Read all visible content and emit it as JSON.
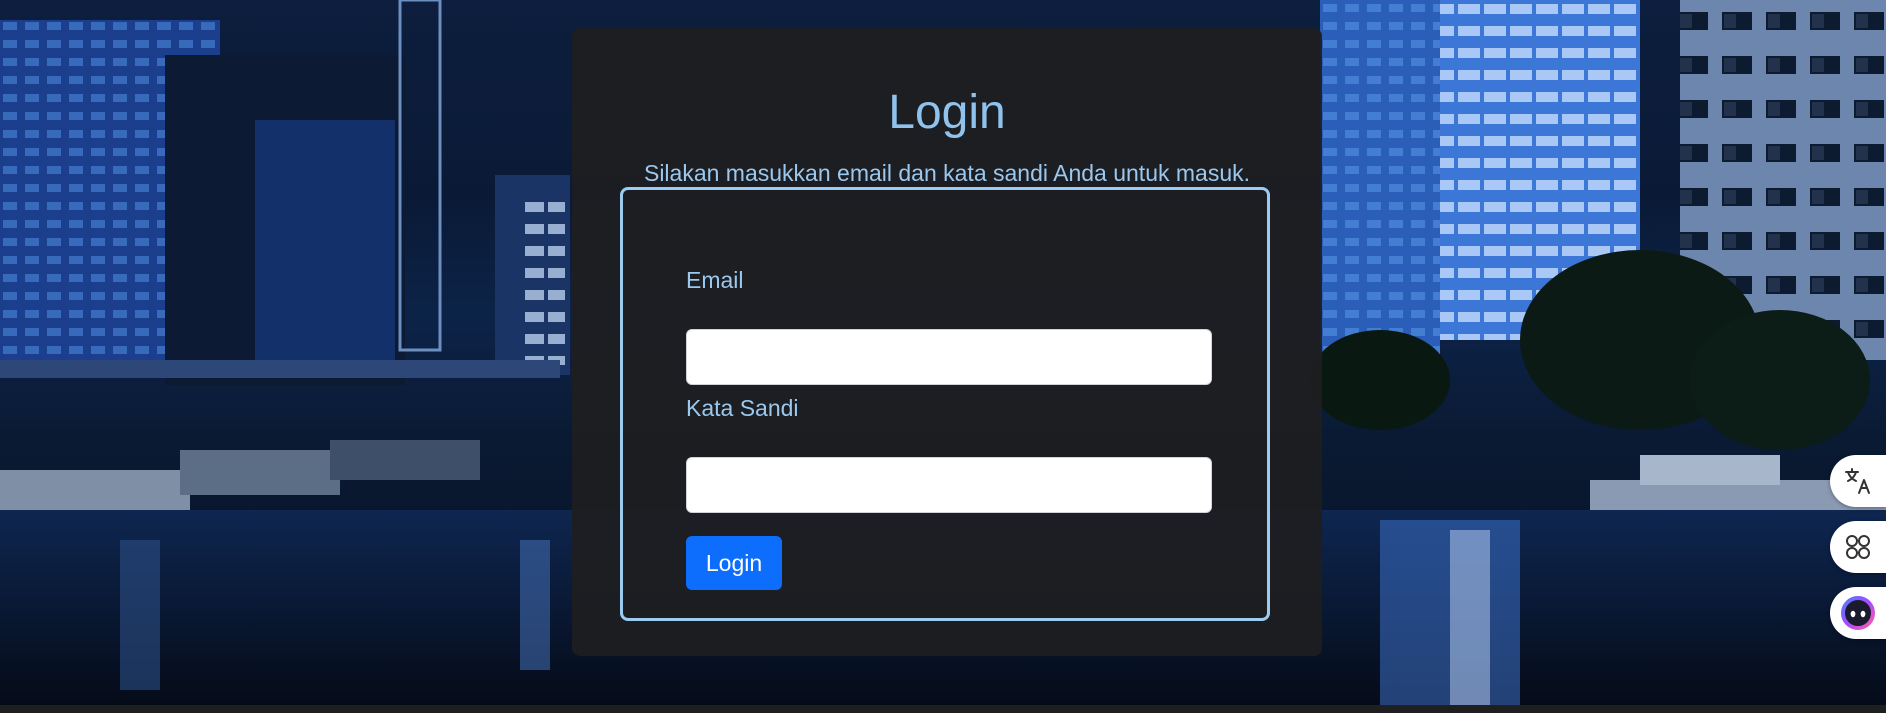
{
  "login": {
    "title": "Login",
    "subtitle": "Silakan masukkan email dan kata sandi Anda untuk masuk.",
    "email_label": "Email",
    "email_value": "",
    "password_label": "Kata Sandi",
    "password_value": "",
    "submit_label": "Login"
  },
  "side_widgets": [
    {
      "icon": "translate-icon"
    },
    {
      "icon": "apps-grid-icon"
    },
    {
      "icon": "assistant-face-icon"
    }
  ],
  "colors": {
    "accent_text": "#9bc8ee",
    "button_primary": "#0d6efd",
    "panel_bg": "#1e1e20",
    "form_border": "#9ccbf0"
  }
}
